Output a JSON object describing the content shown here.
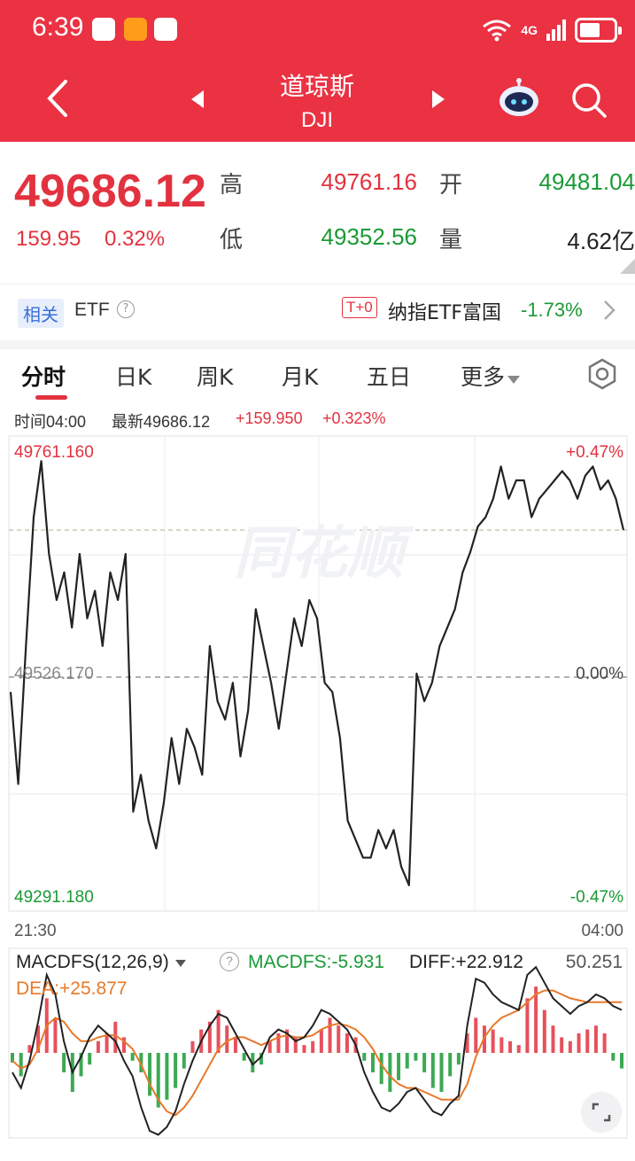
{
  "status_bar": {
    "time": "6:39",
    "network": "4G"
  },
  "header": {
    "name": "道琼斯",
    "code": "DJI"
  },
  "quote": {
    "price": "49686.12",
    "change": "159.95",
    "change_pct": "0.32%",
    "high_label": "高",
    "high": "49761.16",
    "open_label": "开",
    "open": "49481.04",
    "low_label": "低",
    "low": "49352.56",
    "volume_label": "量",
    "volume": "4.62亿"
  },
  "etf_row": {
    "tag": "相关",
    "label": "ETF",
    "help": "?",
    "t0": "T+0",
    "fund": "纳指ETF富国",
    "fund_pct": "-1.73%"
  },
  "tabs": [
    {
      "label": "分时",
      "active": true
    },
    {
      "label": "日K"
    },
    {
      "label": "周K"
    },
    {
      "label": "月K"
    },
    {
      "label": "五日"
    },
    {
      "label": "更多"
    }
  ],
  "info_bar": {
    "time": "时间04:00",
    "last": "最新49686.12",
    "change": "+159.950",
    "pct": "+0.323%"
  },
  "chart_data": {
    "type": "line",
    "y_top_label": "49761.160",
    "y_mid_label": "49526.170",
    "y_bottom_label": "49291.180",
    "pct_top_label": "+0.47%",
    "pct_mid_label": "0.00%",
    "pct_bottom_label": "-0.47%",
    "x_start_label": "21:30",
    "x_end_label": "04:00",
    "ylim": [
      49291.18,
      49761.16
    ],
    "prev_close": 49526.17,
    "watermark": "同花顺",
    "x": [
      0,
      1,
      2,
      3,
      4,
      5,
      6,
      7,
      8,
      9,
      10,
      11,
      12,
      13,
      14,
      15,
      16,
      17,
      18,
      19,
      20,
      21,
      22,
      23,
      24,
      25,
      26,
      27,
      28,
      29,
      30,
      31,
      32,
      33,
      34,
      35,
      36,
      37,
      38,
      39,
      40,
      41,
      42,
      43,
      44,
      45,
      46,
      47,
      48,
      49,
      50,
      51,
      52,
      53,
      54,
      55,
      56,
      57,
      58,
      59,
      60,
      61,
      62,
      63,
      64,
      65,
      66,
      67,
      68,
      69,
      70,
      71,
      72,
      73,
      74,
      75,
      76,
      77,
      78,
      79,
      80
    ],
    "values": [
      49510,
      49410,
      49560,
      49700,
      49761,
      49660,
      49610,
      49640,
      49580,
      49660,
      49590,
      49620,
      49560,
      49640,
      49610,
      49660,
      49380,
      49420,
      49370,
      49340,
      49390,
      49460,
      49410,
      49470,
      49450,
      49420,
      49560,
      49500,
      49480,
      49520,
      49440,
      49490,
      49600,
      49560,
      49520,
      49470,
      49530,
      49590,
      49560,
      49610,
      49590,
      49520,
      49510,
      49460,
      49370,
      49350,
      49330,
      49330,
      49360,
      49340,
      49360,
      49320,
      49300,
      49530,
      49500,
      49520,
      49560,
      49580,
      49600,
      49640,
      49662,
      49690,
      49700,
      49720,
      49755,
      49720,
      49740,
      49740,
      49700,
      49720,
      49730,
      49740,
      49750,
      49740,
      49720,
      49745,
      49755,
      49730,
      49740,
      49720,
      49686
    ],
    "macd": {
      "name": "MACDFS(12,26,9)",
      "macdfs": "MACDFS:-5.931",
      "diff": "DIFF:+22.912",
      "dea": "DEA:+25.877",
      "top_label": "50.251",
      "histogram": [
        -5,
        -12,
        4,
        14,
        28,
        18,
        -10,
        -20,
        -12,
        -6,
        6,
        10,
        16,
        8,
        -4,
        -10,
        -22,
        -28,
        -24,
        -18,
        -8,
        6,
        12,
        16,
        22,
        14,
        8,
        -4,
        -10,
        -6,
        6,
        10,
        12,
        8,
        4,
        6,
        12,
        18,
        14,
        10,
        8,
        -4,
        -10,
        -16,
        -20,
        -14,
        -8,
        -4,
        -10,
        -18,
        -20,
        -12,
        -6,
        10,
        18,
        14,
        12,
        8,
        6,
        4,
        28,
        34,
        22,
        14,
        8,
        6,
        10,
        12,
        14,
        10,
        -4,
        -8
      ],
      "diff_line": [
        -10,
        -18,
        -4,
        16,
        40,
        30,
        6,
        -10,
        -2,
        8,
        14,
        10,
        6,
        -4,
        -12,
        -28,
        -40,
        -42,
        -38,
        -30,
        -16,
        -4,
        6,
        14,
        20,
        18,
        10,
        2,
        -6,
        -2,
        8,
        12,
        10,
        6,
        8,
        14,
        22,
        20,
        16,
        12,
        4,
        -10,
        -20,
        -28,
        -30,
        -26,
        -20,
        -18,
        -24,
        -30,
        -32,
        -26,
        -22,
        14,
        38,
        36,
        30,
        26,
        24,
        22,
        40,
        44,
        36,
        28,
        24,
        20,
        24,
        26,
        30,
        28,
        24,
        22
      ],
      "dea_line": [
        -4,
        -8,
        -6,
        2,
        14,
        18,
        16,
        10,
        6,
        6,
        8,
        9,
        9,
        6,
        2,
        -6,
        -16,
        -24,
        -30,
        -32,
        -28,
        -22,
        -14,
        -6,
        2,
        6,
        8,
        8,
        6,
        4,
        6,
        8,
        9,
        8,
        8,
        9,
        12,
        14,
        15,
        14,
        12,
        8,
        2,
        -6,
        -12,
        -16,
        -18,
        -18,
        -20,
        -22,
        -24,
        -24,
        -24,
        -16,
        -2,
        8,
        14,
        18,
        20,
        22,
        26,
        30,
        32,
        32,
        30,
        28,
        27,
        26,
        26,
        26,
        26,
        26
      ]
    }
  },
  "colors": {
    "brand": "#ea3243",
    "up": "#e2323f",
    "down": "#1a9a35",
    "line": "#222222",
    "dea": "#e8792a"
  }
}
